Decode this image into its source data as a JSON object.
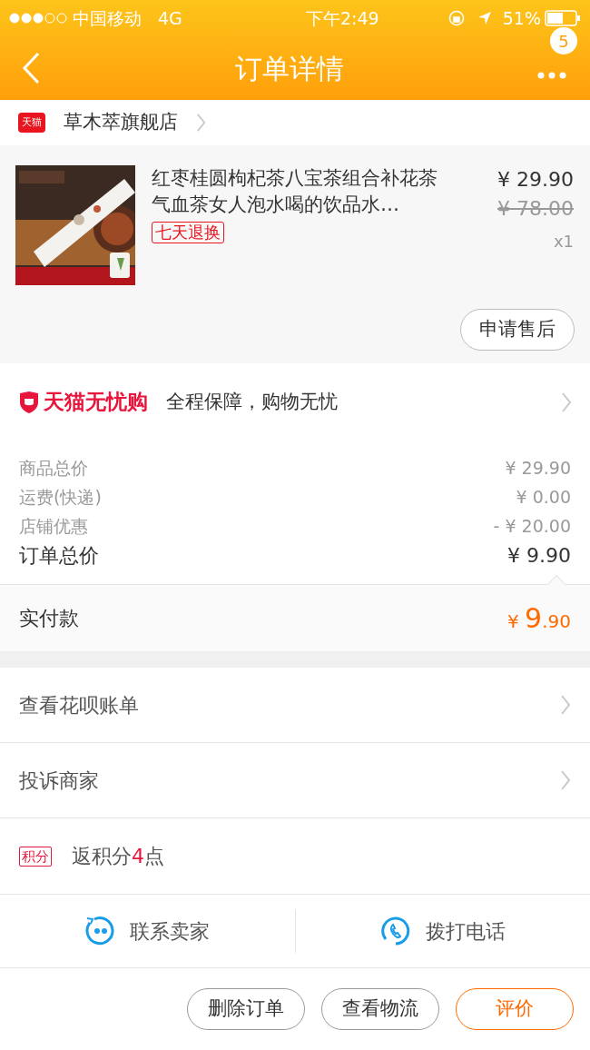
{
  "status_bar": {
    "carrier": "中国移动",
    "network": "4G",
    "time": "下午2:49",
    "battery": "51%"
  },
  "nav": {
    "title": "订单详情",
    "badge": "5"
  },
  "shop": {
    "badge": "天猫",
    "name": "草木萃旗舰店"
  },
  "product": {
    "kind": "picture",
    "title": "红枣桂圆枸杞茶八宝茶组合补花茶气血茶女人泡水喝的饮品水…",
    "tag": "七天退换",
    "price": "¥ 29.90",
    "original_price": "¥ 78.00",
    "quantity": "x1",
    "action": "申请售后"
  },
  "guarantee": {
    "brand": "天猫无忧购",
    "text": "全程保障，购物无忧"
  },
  "summary": [
    {
      "label": "商品总价",
      "value": "¥ 29.90",
      "kind": "minor"
    },
    {
      "label": "运费(快递)",
      "value": "¥ 0.00",
      "kind": "minor"
    },
    {
      "label": "店铺优惠",
      "value": "- ¥ 20.00",
      "kind": "minor"
    },
    {
      "label": "订单总价",
      "value": "¥ 9.90",
      "kind": "total"
    }
  ],
  "paid": {
    "label": "实付款",
    "currency": "¥",
    "integer": "9",
    "decimal": ".90"
  },
  "links": [
    {
      "label": "查看花呗账单"
    },
    {
      "label": "投诉商家"
    }
  ],
  "points": {
    "badge": "积分",
    "before": "返积分",
    "value": "4",
    "after": "点"
  },
  "contact": [
    {
      "label": "联系卖家",
      "kind": "chat"
    },
    {
      "label": "拨打电话",
      "kind": "phone"
    }
  ],
  "actions": [
    {
      "label": "删除订单",
      "primary": false
    },
    {
      "label": "查看物流",
      "primary": false
    },
    {
      "label": "评价",
      "primary": true
    }
  ]
}
